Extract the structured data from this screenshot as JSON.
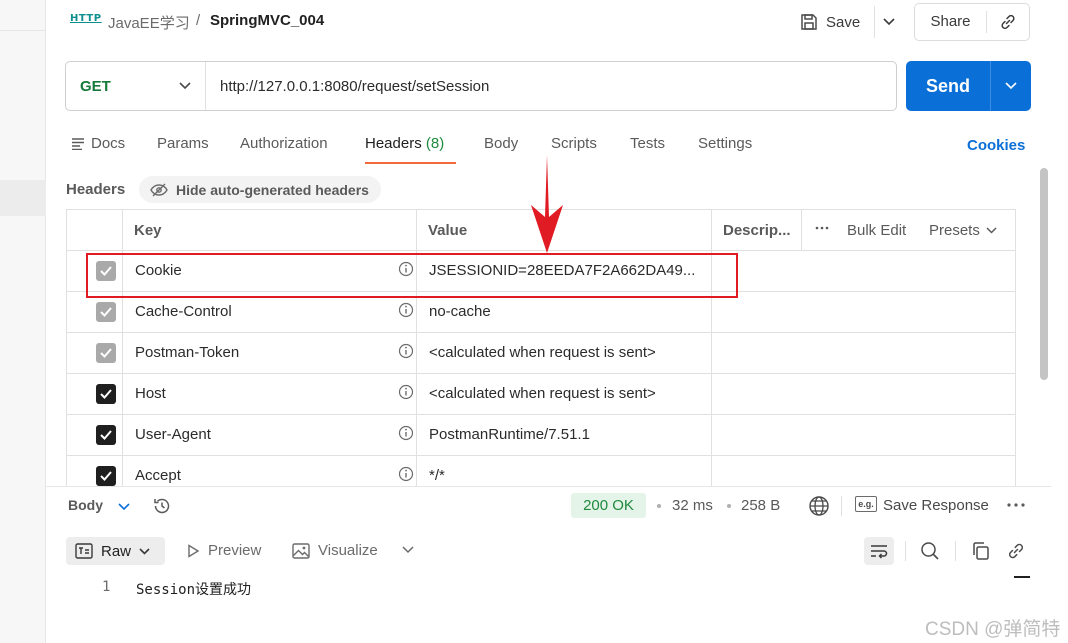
{
  "breadcrumb": {
    "icon": "http-icon",
    "http_glyph": "HTTP",
    "collection": "JavaEE学习",
    "separator": "/",
    "request": "SpringMVC_004"
  },
  "toolbar": {
    "save_label": "Save",
    "share_label": "Share"
  },
  "request": {
    "method": "GET",
    "url": "http://127.0.0.1:8080/request/setSession",
    "send_label": "Send"
  },
  "tabs": [
    {
      "label": "Docs"
    },
    {
      "label": "Params"
    },
    {
      "label": "Authorization"
    },
    {
      "label": "Headers",
      "count": "(8)",
      "active": true
    },
    {
      "label": "Body"
    },
    {
      "label": "Scripts"
    },
    {
      "label": "Tests"
    },
    {
      "label": "Settings"
    }
  ],
  "cookies_label": "Cookies",
  "headers_section": {
    "title": "Headers",
    "hide_label": "Hide auto-generated headers",
    "columns": {
      "key": "Key",
      "value": "Value",
      "description": "Descrip...",
      "bulk_edit": "Bulk Edit",
      "presets": "Presets"
    },
    "rows": [
      {
        "key": "Cookie",
        "value": "JSESSIONID=28EEDA7F2A662DA49...",
        "checked": true,
        "auto": true
      },
      {
        "key": "Cache-Control",
        "value": "no-cache",
        "checked": true,
        "auto": true
      },
      {
        "key": "Postman-Token",
        "value": "<calculated when request is sent>",
        "checked": true,
        "auto": true
      },
      {
        "key": "Host",
        "value": "<calculated when request is sent>",
        "checked": true,
        "auto": false
      },
      {
        "key": "User-Agent",
        "value": "PostmanRuntime/7.51.1",
        "checked": true,
        "auto": false
      },
      {
        "key": "Accept",
        "value": "*/*",
        "checked": true,
        "auto": false
      }
    ]
  },
  "response": {
    "body_label": "Body",
    "status": "200 OK",
    "time": "32 ms",
    "size": "258 B",
    "eg_badge": "e.g.",
    "save_response_label": "Save Response",
    "view_modes": {
      "raw": "Raw",
      "preview": "Preview",
      "visualize": "Visualize"
    },
    "lines": [
      {
        "no": "1",
        "text": "Session设置成功"
      }
    ]
  },
  "watermark": "CSDN @弹简特",
  "colors": {
    "accent": "#0b6fd8",
    "method": "#157a3a",
    "status_ok": "#1f8a3e",
    "tab_underline": "#f26b3a",
    "annotation": "#e01b24"
  }
}
